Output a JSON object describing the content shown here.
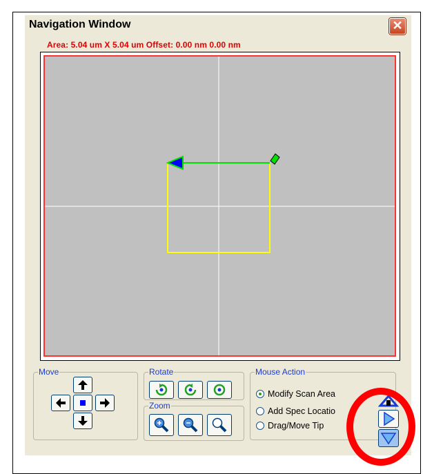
{
  "window": {
    "title": "Navigation Window",
    "status_text": "Area: 5.04 um X 5.04 um Offset: 0.00 nm 0.00 nm"
  },
  "canvas": {
    "icons": [
      "scan-direction-arrow-icon",
      "tip-marker-icon"
    ]
  },
  "move": {
    "label": "Move",
    "buttons": [
      "up-arrow-icon",
      "left-arrow-icon",
      "center-square-icon",
      "right-arrow-icon",
      "down-arrow-icon"
    ]
  },
  "rotate": {
    "label": "Rotate",
    "buttons": [
      "rotate-cw-icon",
      "rotate-ccw-icon",
      "reset-rotation-icon"
    ]
  },
  "zoom": {
    "label": "Zoom",
    "buttons": [
      "zoom-in-icon",
      "zoom-out-icon",
      "zoom-reset-icon"
    ]
  },
  "mouse_action": {
    "label": "Mouse Action",
    "options": [
      "Modify Scan Area",
      "Add Spec Locatio",
      "Drag/Move Tip"
    ],
    "selected": "Modify Scan Area"
  },
  "side_buttons": [
    "tip-approach-icon",
    "expand-right-icon",
    "expand-down-icon"
  ],
  "colors": {
    "status_text": "#e00000",
    "canvas_bg": "#c0c0c0",
    "frame": "#ff3030",
    "scan_box": "#ffff00",
    "arrow": "#00e000",
    "highlight": "#ff0000"
  }
}
